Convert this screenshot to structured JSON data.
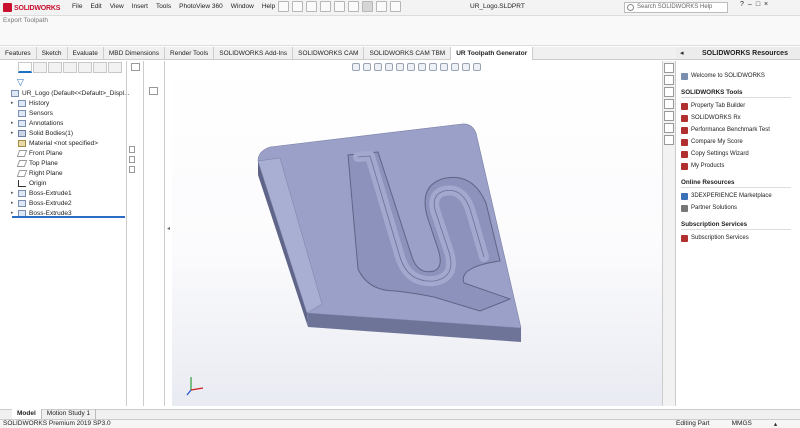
{
  "app": {
    "logo_text": "SOLIDWORKS",
    "document_title": "UR_Logo.SLDPRT",
    "menu": [
      "File",
      "Edit",
      "View",
      "Insert",
      "Tools",
      "PhotoView 360",
      "Window",
      "Help"
    ],
    "search_placeholder": "Search SOLIDWORKS Help",
    "window_controls": [
      "?",
      "–",
      "□",
      "×"
    ]
  },
  "toolbar2": {
    "export_label": "Export Toolpath"
  },
  "command_tabs": [
    "Features",
    "Sketch",
    "Evaluate",
    "MBD Dimensions",
    "Render Tools",
    "SOLIDWORKS Add-Ins",
    "SOLIDWORKS CAM",
    "SOLIDWORKS CAM TBM",
    "UR Toolpath Generator"
  ],
  "active_command_tab": "UR Toolpath Generator",
  "feature_tree": {
    "root": "UR_Logo  (Default<<Default>_Displ...",
    "items": [
      {
        "label": "History",
        "icon": "history-icon",
        "expand": "▸"
      },
      {
        "label": "Sensors",
        "icon": "sensor-icon",
        "expand": ""
      },
      {
        "label": "Annotations",
        "icon": "annotation-icon",
        "expand": "▸"
      },
      {
        "label": "Solid Bodies(1)",
        "icon": "solid-body-icon",
        "expand": "▸"
      },
      {
        "label": "Material <not specified>",
        "icon": "material-icon",
        "expand": ""
      },
      {
        "label": "Front Plane",
        "icon": "plane-icon",
        "expand": ""
      },
      {
        "label": "Top Plane",
        "icon": "plane-icon",
        "expand": ""
      },
      {
        "label": "Right Plane",
        "icon": "plane-icon",
        "expand": ""
      },
      {
        "label": "Origin",
        "icon": "origin-icon",
        "expand": ""
      },
      {
        "label": "Boss-Extrude1",
        "icon": "extrude-icon",
        "expand": "▸"
      },
      {
        "label": "Boss-Extrude2",
        "icon": "extrude-icon",
        "expand": "▸"
      },
      {
        "label": "Boss-Extrude3",
        "icon": "extrude-icon",
        "expand": "▸"
      }
    ]
  },
  "resources": {
    "title": "SOLIDWORKS Resources",
    "welcome": "Welcome to SOLIDWORKS",
    "sections": [
      {
        "title": "SOLIDWORKS Tools",
        "items": [
          {
            "label": "Property Tab Builder",
            "color": "#b03030"
          },
          {
            "label": "SOLIDWORKS Rx",
            "color": "#b03030"
          },
          {
            "label": "Performance Benchmark Test",
            "color": "#b03030"
          },
          {
            "label": "Compare My Score",
            "color": "#b03030"
          },
          {
            "label": "Copy Settings Wizard",
            "color": "#b03030"
          },
          {
            "label": "My Products",
            "color": "#b03030"
          }
        ]
      },
      {
        "title": "Online Resources",
        "items": [
          {
            "label": "3DEXPERIENCE Marketplace",
            "color": "#3b6fb6"
          },
          {
            "label": "Partner Solutions",
            "color": "#777777"
          }
        ]
      },
      {
        "title": "Subscription Services",
        "items": [
          {
            "label": "Subscription Services",
            "color": "#b03030"
          }
        ]
      }
    ]
  },
  "bottom_tabs": [
    "Model",
    "Motion Study 1"
  ],
  "status": {
    "left": "SOLIDWORKS Premium 2019 SP3.0",
    "mode": "Editing Part",
    "units": "MMGS",
    "arrow": "▴"
  },
  "colors": {
    "part_top": "#9aa0c7",
    "part_side": "#6e7398",
    "accent": "#2b6cc4"
  }
}
